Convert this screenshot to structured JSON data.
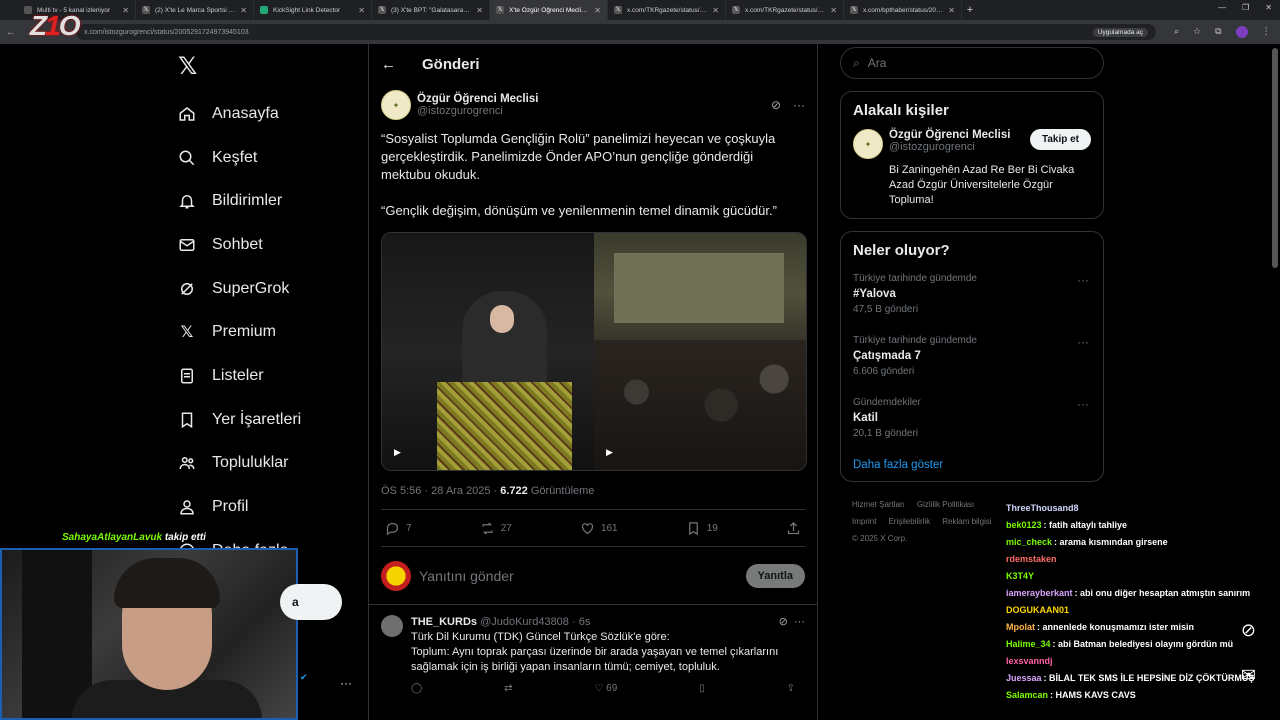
{
  "browser": {
    "tabs": [
      {
        "title": "Multi tv - 5 kanal izleniyor",
        "active": false
      },
      {
        "title": "(2) X'te Le Marca Sportsi \"Erde",
        "active": false
      },
      {
        "title": "KickSight Link Detector",
        "active": false
      },
      {
        "title": "(3) X'te BPT: \"Galatasaray, Sarp",
        "active": false
      },
      {
        "title": "X'te Özgür Öğrenci Meclisi: \"S",
        "active": true
      },
      {
        "title": "x.com/TKRgazete/status/20056",
        "active": false
      },
      {
        "title": "x.com/TKRgazete/status/20056",
        "active": false
      },
      {
        "title": "x.com/bpthaber/status/200562",
        "active": false
      }
    ],
    "url": "x.com/istozgurogrenci/status/2005291724973945103",
    "app_pill": "Uygulamada aç"
  },
  "nav": {
    "items": [
      {
        "label": "Anasayfa",
        "icon": "home-icon"
      },
      {
        "label": "Keşfet",
        "icon": "search-icon"
      },
      {
        "label": "Bildirimler",
        "icon": "bell-icon"
      },
      {
        "label": "Sohbet",
        "icon": "mail-icon"
      },
      {
        "label": "SuperGrok",
        "icon": "grok-icon"
      },
      {
        "label": "Premium",
        "icon": "x-logo-icon"
      },
      {
        "label": "Listeler",
        "icon": "list-icon"
      },
      {
        "label": "Yer İşaretleri",
        "icon": "bookmark-icon"
      },
      {
        "label": "Topluluklar",
        "icon": "people-icon"
      },
      {
        "label": "Profil",
        "icon": "person-icon"
      },
      {
        "label": "Daha fazla",
        "icon": "more-icon"
      }
    ],
    "post_button_fragment": "a"
  },
  "header": {
    "title": "Gönderi"
  },
  "post": {
    "author_name": "Özgür Öğrenci Meclisi",
    "author_handle": "@istozgurogrenci",
    "text_1": "“Sosyalist Toplumda Gençliğin Rolü” panelimizi heyecan ve çoşkuyla gerçekleştirdik. Panelimizde Önder APO’nun gençliğe gönderdiği mektubu okuduk.",
    "text_2": "“Gençlik değişim, dönüşüm ve yenilenmenin temel dinamik gücüdür.”",
    "time": "ÖS 5:56 · 28 Ara 2025 · ",
    "views": "6.722",
    "views_label": " Görüntüleme",
    "replies": "7",
    "reposts": "27",
    "likes": "161",
    "bookmarks": "19"
  },
  "reply_box": {
    "placeholder": "Yanıtını gönder",
    "button": "Yanıtla"
  },
  "reply": {
    "name": "THE_KURDs",
    "handle": "@JudoKurd43808 · 6s",
    "line1": "Türk Dil Kurumu (TDK) Güncel Türkçe Sözlük'e göre:",
    "line2": "Toplum: Aynı toprak parçası üzerinde bir arada yaşayan ve temel çıkarlarını sağlamak için iş birliği yapan insanların tümü; cemiyet, topluluk.",
    "likes": "69"
  },
  "right": {
    "search_placeholder": "Ara",
    "related_title": "Alakalı kişiler",
    "related_name": "Özgür Öğrenci Meclisi",
    "related_handle": "@istozgurogrenci",
    "follow_label": "Takip et",
    "bio": "Bi Zaningehên Azad Re Ber Bi Civaka Azad Özgür Üniversitelerle Özgür Topluma!",
    "trends_title": "Neler oluyor?",
    "trends": [
      {
        "context": "Türkiye tarihinde gündemde",
        "title": "#Yalova",
        "count": "47,5 B gönderi"
      },
      {
        "context": "Türkiye tarihinde gündemde",
        "title": "Çatışmada 7",
        "count": "6.606 gönderi"
      },
      {
        "context": "Gündemdekiler",
        "title": "Katil",
        "count": "20,1 B gönderi"
      }
    ],
    "show_more": "Daha fazla göster",
    "footer_line1": [
      "Hizmet Şartları",
      "Gizlilik Politikası"
    ],
    "footer_line2": [
      "Imprint",
      "Erişilebilirlik",
      "Reklam bilgisi"
    ],
    "copyright": "© 2025 X Corp."
  },
  "overlay": {
    "follow_user": "SahayaAtlayanLavuk",
    "follow_text": " takip etti",
    "chat": [
      {
        "user": "ThreeThousand8",
        "msg": "",
        "color": "#cfd8ff"
      },
      {
        "user": "bek0123",
        "msg": "fatih altaylı tahliye",
        "color": "#7CFC00"
      },
      {
        "user": "mic_check",
        "msg": "arama kısmından girsene",
        "color": "#7CFC00"
      },
      {
        "user": "rdemstaken",
        "msg": "",
        "color": "#ff6b6b"
      },
      {
        "user": "K3T4Y",
        "msg": "",
        "color": "#7CFC00"
      },
      {
        "user": "iameraybеrkant",
        "msg": "abi onu diğer hesaptan atmıştın sanırım",
        "color": "#d9a3ff"
      },
      {
        "user": "DOGUKAAN01",
        "msg": "",
        "color": "#ffd700"
      },
      {
        "user": "Mpolat",
        "msg": "annenlede konuşmamızı ister misin",
        "color": "#ffb347"
      },
      {
        "user": "Halime_34",
        "msg": "abi Batman belediyesi olayını gördün mü",
        "color": "#7CFC00"
      },
      {
        "user": "lexsvanndj",
        "msg": "",
        "color": "#ff5fa2"
      },
      {
        "user": "Juessaa",
        "msg": "BİLAL TEK SMS İLE HEPSİNE DİZ ÇÖKTÜRMÜŞ",
        "color": "#d9a3ff"
      },
      {
        "user": "Salamcan",
        "msg": "HAMS KAVS CAVS",
        "color": "#7CFC00"
      }
    ]
  }
}
